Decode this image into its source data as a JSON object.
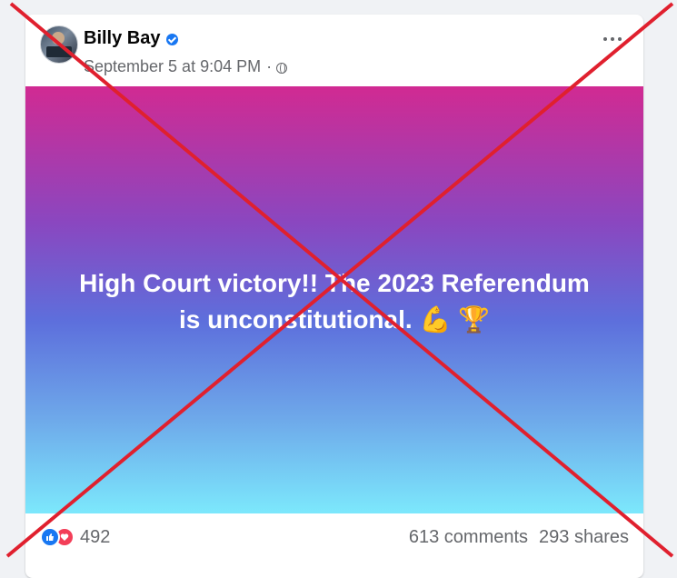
{
  "post": {
    "author": "Billy Bay",
    "timestamp": "September 5 at 9:04 PM",
    "separator": "·",
    "audience_icon": "globe-icon",
    "verified_icon": "verified-badge-icon",
    "more_icon": "more-options-icon",
    "text_line1": "High Court victory!! The 2023 Referendum",
    "text_line2": "is unconstitutional.",
    "emoji_1": "💪",
    "emoji_2": "🏆"
  },
  "engagement": {
    "reaction_icons": [
      "like-icon",
      "love-icon"
    ],
    "reaction_count": "492",
    "comments": "613 comments",
    "shares": "293 shares"
  },
  "overlay": {
    "type": "red-cross-out",
    "color": "#e0202e"
  },
  "colors": {
    "gradient_top": "#d12a92",
    "gradient_mid": "#5d6fdc",
    "gradient_bottom": "#7ce8fc",
    "facebook_blue": "#1877f2",
    "love_red": "#f33e58"
  }
}
